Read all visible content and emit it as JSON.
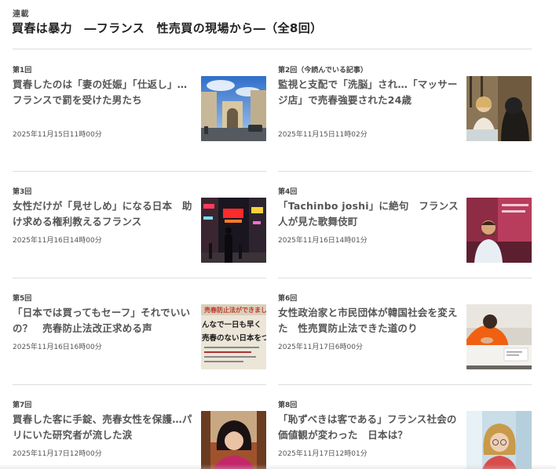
{
  "series": {
    "label": "連載",
    "title": "買春は暴力　―フランス　性売買の現場から―（全8回）"
  },
  "articles": [
    {
      "episode": "第1回",
      "headline": "買春したのは「妻の妊娠」「仕返し」…フランスで罰を受けた男たち",
      "date": "2025年11月15日11時00分",
      "image": "paris-street-arch-photo"
    },
    {
      "episode": "第2回（今読んでいる記事）",
      "headline": "監視と支配で「洗脳」され…「マッサージ店」で売春強要された24歳",
      "date": "2025年11月15日11時02分",
      "image": "interview-women-photo"
    },
    {
      "episode": "第3回",
      "headline": "女性だけが「見せしめ」になる日本　助け求める権利教えるフランス",
      "date": "2025年11月16日14時00分",
      "image": "night-street-neon-photo"
    },
    {
      "episode": "第4回",
      "headline": "「Tachinbo joshi」に絶句　フランス人が見た歌舞伎町",
      "date": "2025年11月16日14時01分",
      "image": "man-speaking-photo"
    },
    {
      "episode": "第5回",
      "headline": "「日本では買ってもセーフ」それでいいの？　売春防止法改正求める声",
      "date": "2025年11月16日16時00分",
      "image": "protest-banner-photo",
      "image_text": [
        "売春防止法ができました",
        "んなで一日も早く",
        "売春のない日本をつくりまし"
      ]
    },
    {
      "episode": "第6回",
      "headline": "女性政治家と市民団体が韓国社会を変えた　性売買防止法できた道のり",
      "date": "2025年11月17日6時00分",
      "image": "meeting-table-photo"
    },
    {
      "episode": "第7回",
      "headline": "買春した客に手錠、売春女性を保護…パリにいた研究者が流した涙",
      "date": "2025年11月17日12時00分",
      "image": "researcher-portrait-photo"
    },
    {
      "episode": "第8回",
      "headline": "「恥ずべきは客である」フランス社会の価値観が変わった　日本は？",
      "date": "2025年11月17日12時01分",
      "image": "woman-glasses-portrait-photo"
    }
  ],
  "colors": {
    "text_dark": "#222222",
    "text_gray": "#555555",
    "rule": "#dddddd"
  }
}
